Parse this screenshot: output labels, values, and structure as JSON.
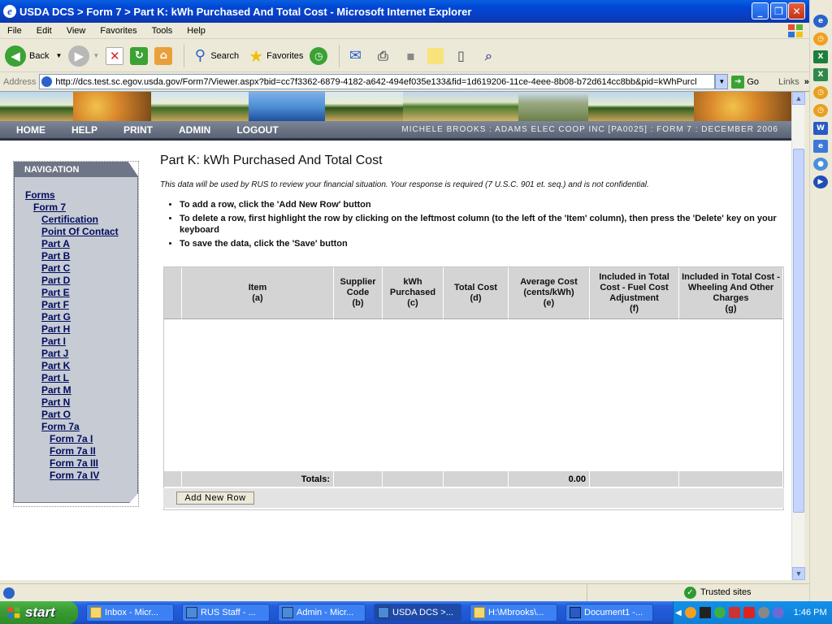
{
  "window": {
    "title": "USDA DCS > Form 7 > Part K: kWh Purchased And Total Cost - Microsoft Internet Explorer",
    "minimize": "_",
    "maximize": "❐",
    "close": "✕"
  },
  "menu": [
    "File",
    "Edit",
    "View",
    "Favorites",
    "Tools",
    "Help"
  ],
  "toolbar": {
    "back": "Back",
    "search": "Search",
    "favorites": "Favorites"
  },
  "address": {
    "label": "Address",
    "url": "http://dcs.test.sc.egov.usda.gov/Form7/Viewer.aspx?bid=cc7f3362-6879-4182-a642-494ef035e133&fid=1d619206-11ce-4eee-8b08-b72d614cc8bb&pid=kWhPurcl",
    "go": "Go",
    "links": "Links"
  },
  "site_nav": {
    "links": [
      "HOME",
      "HELP",
      "PRINT",
      "ADMIN",
      "LOGOUT"
    ],
    "user_info": "MICHELE BROOKS : ADAMS ELEC COOP INC [PA0025] : FORM 7 : DECEMBER 2006"
  },
  "left_nav": {
    "heading": "NAVIGATION",
    "forms": "Forms",
    "form7": "Form 7",
    "items": [
      "Certification",
      "Point Of Contact",
      "Part A",
      "Part B",
      "Part C",
      "Part D",
      "Part E",
      "Part F",
      "Part G",
      "Part H",
      "Part I",
      "Part J",
      "Part K",
      "Part L",
      "Part M",
      "Part N",
      "Part O",
      "Form 7a"
    ],
    "sub_items": [
      "Form 7a I",
      "Form 7a II",
      "Form 7a III",
      "Form 7a IV"
    ]
  },
  "main": {
    "title": "Part K: kWh Purchased And Total Cost",
    "notice": "This data will be used by RUS to review your financial situation. Your response is required (7 U.S.C. 901 et. seq.) and is not confidential.",
    "instructions": [
      "To add a row, click the 'Add New Row' button",
      "To delete a row, first highlight the row by clicking on the leftmost column (to the left of the 'Item' column), then press the 'Delete' key on your keyboard",
      "To save the data, click the 'Save' button"
    ],
    "columns": [
      {
        "label": "Item",
        "sub": "(a)"
      },
      {
        "label": "Supplier Code",
        "sub": "(b)"
      },
      {
        "label": "kWh Purchased",
        "sub": "(c)"
      },
      {
        "label": "Total Cost",
        "sub": "(d)"
      },
      {
        "label": "Average Cost (cents/kWh)",
        "sub": "(e)"
      },
      {
        "label": "Included in Total Cost - Fuel Cost Adjustment",
        "sub": "(f)"
      },
      {
        "label": "Included in Total Cost - Wheeling And Other Charges",
        "sub": "(g)"
      }
    ],
    "totals_label": "Totals:",
    "totals_avg_cost": "0.00",
    "add_row_button": "Add New Row"
  },
  "status": {
    "zone": "Trusted sites"
  },
  "taskbar": {
    "start": "start",
    "tasks": [
      "Inbox - Micr...",
      "RUS Staff - ...",
      "Admin - Micr...",
      "USDA DCS >...",
      "H:\\Mbrooks\\...",
      "Document1 -..."
    ],
    "clock": "1:46 PM"
  },
  "colors": {
    "nav_bar": "#5a6373",
    "nav_panel": "#c7cbd3",
    "grid_header": "#d4d4d4",
    "link": "#000d5f"
  }
}
